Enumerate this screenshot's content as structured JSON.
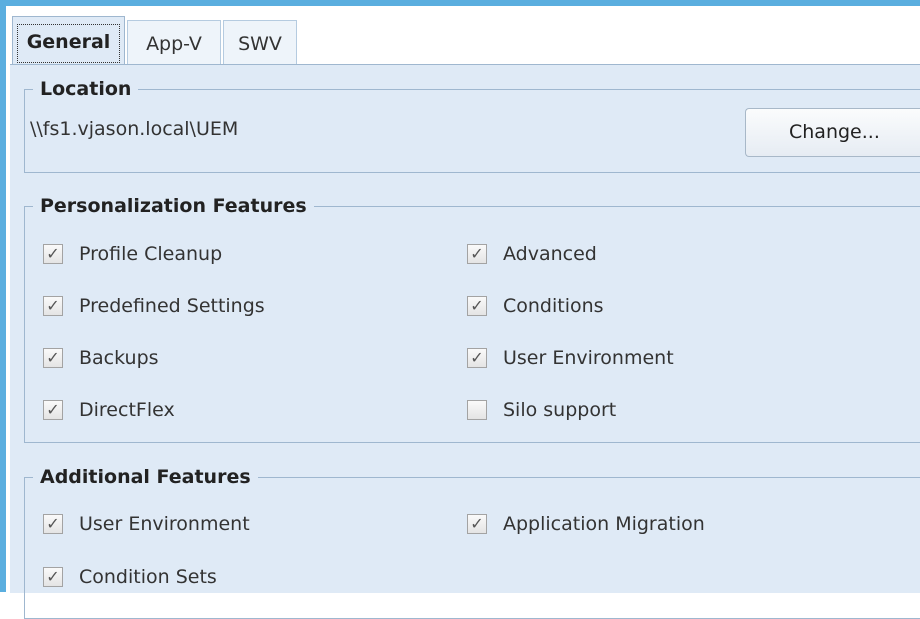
{
  "tabs": [
    {
      "label": "General",
      "active": true
    },
    {
      "label": "App-V",
      "active": false
    },
    {
      "label": "SWV",
      "active": false
    }
  ],
  "location": {
    "title": "Location",
    "path": "\\\\fs1.vjason.local\\UEM",
    "change_button": "Change..."
  },
  "personalization": {
    "title": "Personalization Features",
    "items": [
      {
        "label": "Profile Cleanup",
        "checked": true
      },
      {
        "label": "Predefined Settings",
        "checked": true
      },
      {
        "label": "Backups",
        "checked": true
      },
      {
        "label": "DirectFlex",
        "checked": true
      },
      {
        "label": "Advanced",
        "checked": true
      },
      {
        "label": "Conditions",
        "checked": true
      },
      {
        "label": "User Environment",
        "checked": true
      },
      {
        "label": "Silo support",
        "checked": false
      }
    ]
  },
  "additional": {
    "title": "Additional Features",
    "items": [
      {
        "label": "User Environment",
        "checked": true
      },
      {
        "label": "Condition Sets",
        "checked": true
      },
      {
        "label": "Application Migration",
        "checked": true
      }
    ]
  },
  "colors": {
    "frame": "#5aaedf",
    "panel": "#dfeaf6",
    "group_border": "#9fb7cf"
  }
}
